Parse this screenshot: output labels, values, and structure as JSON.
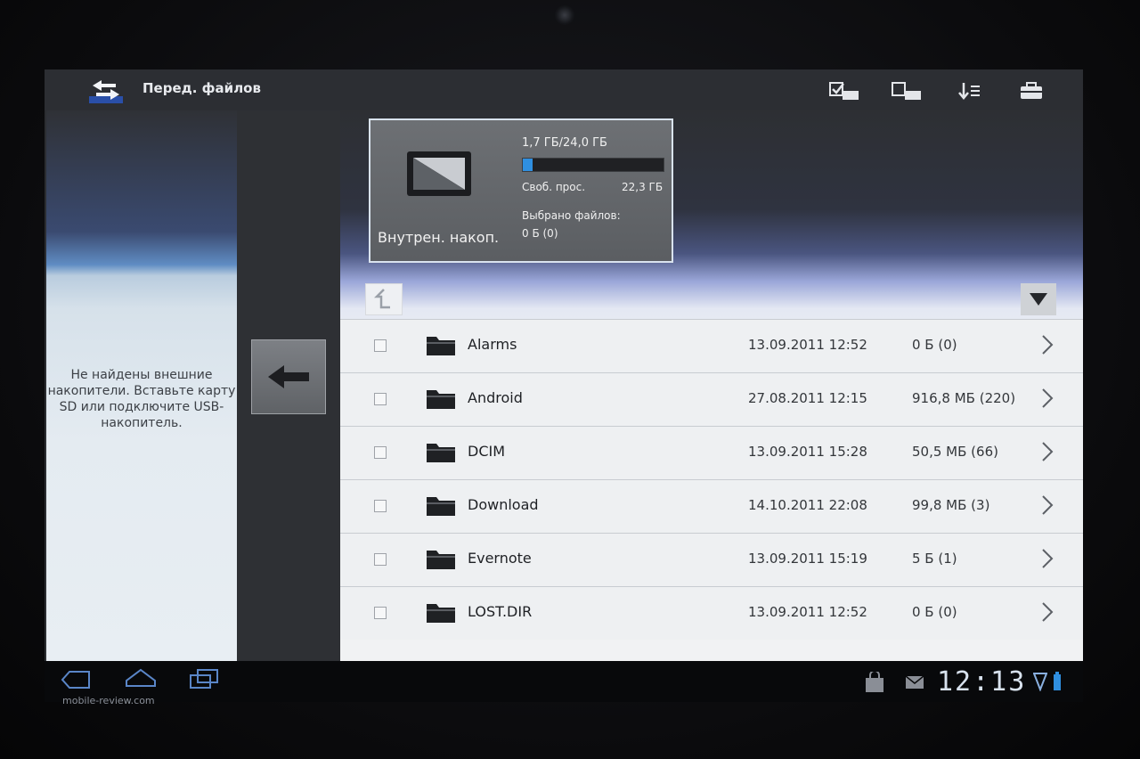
{
  "app": {
    "title": "Перед. файлов",
    "icon": "transfer-arrows-icon",
    "toolbar": [
      {
        "name": "select-all-icon"
      },
      {
        "name": "deselect-all-icon"
      },
      {
        "name": "sort-list-icon"
      },
      {
        "name": "toolbox-icon"
      }
    ]
  },
  "left_panel": {
    "message": "Не найдены внешние накопители. Вставьте карту SD или подключите USB-накопитель."
  },
  "storage": {
    "name": "Внутрен. накоп.",
    "used": "1,7 ГБ/24,0 ГБ",
    "used_fraction": 0.07,
    "free_label": "Своб. прос.",
    "free_value": "22,3 ГБ",
    "selected_label": "Выбрано файлов:",
    "selected_value": "0 Б (0)"
  },
  "files": [
    {
      "name": "Alarms",
      "date": "13.09.2011 12:52",
      "size": "0 Б (0)"
    },
    {
      "name": "Android",
      "date": "27.08.2011 12:15",
      "size": "916,8 МБ (220)"
    },
    {
      "name": "DCIM",
      "date": "13.09.2011 15:28",
      "size": "50,5 МБ (66)"
    },
    {
      "name": "Download",
      "date": "14.10.2011 22:08",
      "size": "99,8 МБ (3)"
    },
    {
      "name": "Evernote",
      "date": "13.09.2011 15:19",
      "size": "5 Б (1)"
    },
    {
      "name": "LOST.DIR",
      "date": "13.09.2011 12:52",
      "size": "0 Б (0)"
    }
  ],
  "statusbar": {
    "time": "12:13"
  },
  "watermark": "mobile-review.com",
  "colors": {
    "accent": "#2f8fe0",
    "screen_bg": "#2b2d31"
  }
}
